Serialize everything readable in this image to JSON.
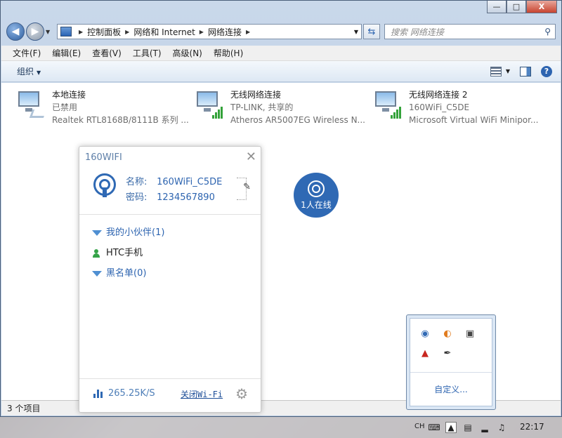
{
  "window": {
    "breadcrumbs": [
      "控制面板",
      "网络和 Internet",
      "网络连接"
    ],
    "search_placeholder": "搜索 网络连接",
    "minimize": "—",
    "maximize": "□",
    "close": "X"
  },
  "menu": [
    "文件(F)",
    "编辑(E)",
    "查看(V)",
    "工具(T)",
    "高级(N)",
    "帮助(H)"
  ],
  "toolbar": {
    "organize": "组织"
  },
  "connections": [
    {
      "name": "本地连接",
      "status": "已禁用",
      "device": "Realtek RTL8168B/8111B 系列 ..."
    },
    {
      "name": "无线网络连接",
      "status": "TP-LINK, 共享的",
      "device": "Atheros AR5007EG Wireless N..."
    },
    {
      "name": "无线网络连接 2",
      "status": "160WiFi_C5DE",
      "device": "Microsoft Virtual WiFi Minipor..."
    }
  ],
  "status_bar": {
    "count": "3 个项目"
  },
  "wifi_panel": {
    "title": "160WIFI",
    "name_label": "名称:",
    "name_value": "160WiFi_C5DE",
    "password_label": "密码:",
    "password_value": "1234567890",
    "group_friends": "我的小伙伴(1)",
    "device": "HTC手机",
    "group_blacklist": "黑名单(0)",
    "speed": "265.25K/S",
    "close_wifi": "关闭Wi-Fi"
  },
  "online_badge": {
    "label": "1人在线"
  },
  "tray_popup": {
    "customize": "自定义..."
  },
  "taskbar": {
    "lang": "CH",
    "time": "22:17"
  },
  "colors": {
    "accent": "#2f69b4",
    "green": "#35a348"
  }
}
